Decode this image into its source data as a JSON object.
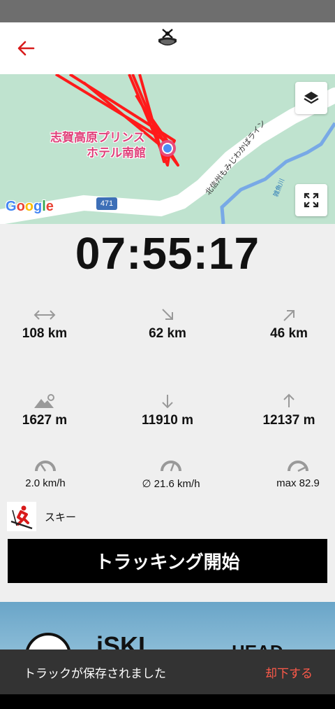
{
  "header": {
    "back_icon": "arrow-left-icon",
    "logo_icon": "ski-helmet-logo-icon",
    "accent": "#d81b1b"
  },
  "map": {
    "poi_label_line1": "志賀高原プリンス",
    "poi_label_line2": "ホテル南館",
    "road_label": "北信州もみじわかばライン",
    "river_label": "雑魚川",
    "route_shield": "471",
    "google_logo": "Google",
    "layers_icon": "layers-icon",
    "fullscreen_icon": "fullscreen-icon",
    "track_color": "#ff1a1a"
  },
  "tracking": {
    "elapsed_time": "07:55:17",
    "stats": [
      {
        "icon": "horizontal-arrows-icon",
        "value": "108 km"
      },
      {
        "icon": "arrow-down-right-icon",
        "value": "62 km"
      },
      {
        "icon": "arrow-up-right-icon",
        "value": "46 km"
      },
      {
        "icon": "mountain-pin-icon",
        "value": "1627 m"
      },
      {
        "icon": "arrow-down-icon",
        "value": "11910 m"
      },
      {
        "icon": "arrow-up-icon",
        "value": "12137 m"
      }
    ],
    "speeds": [
      {
        "icon": "speedometer-low-icon",
        "value": "2.0 km/h"
      },
      {
        "icon": "speedometer-avg-icon",
        "value": "∅ 21.6 km/h"
      },
      {
        "icon": "speedometer-max-icon",
        "value": "max 82.9"
      }
    ]
  },
  "activity": {
    "icon": "skier-icon",
    "label": "スキー"
  },
  "start_button": {
    "label": "トラッキング開始"
  },
  "banner": {
    "brand1": "iSKI",
    "brand2": "HEAD"
  },
  "snackbar": {
    "message": "トラックが保存されました",
    "action": "却下する",
    "action_color": "#ff5a4a"
  }
}
